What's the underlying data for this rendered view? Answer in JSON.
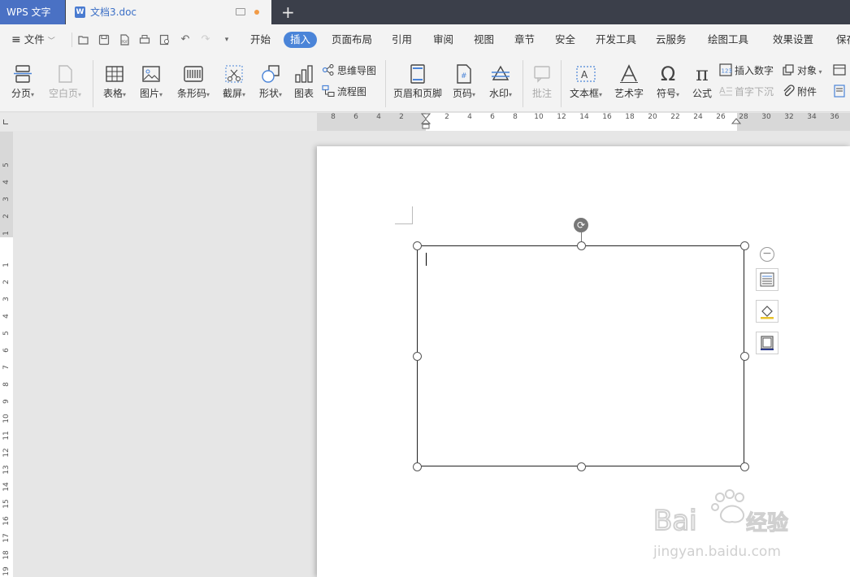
{
  "titlebar": {
    "app_name": "WPS 文字",
    "document_tab": "文档3.doc",
    "new_tab_symbol": "+"
  },
  "menubar": {
    "file_label": "文件",
    "items": [
      "开始",
      "插入",
      "页面布局",
      "引用",
      "审阅",
      "视图",
      "章节",
      "安全",
      "开发工具",
      "云服务",
      "绘图工具",
      "效果设置",
      "保存"
    ],
    "active_item": "插入"
  },
  "ribbon": {
    "page_break": "分页",
    "blank_page": "空白页",
    "table": "表格",
    "picture": "图片",
    "barcode": "条形码",
    "screenshot": "截屏",
    "shape": "形状",
    "chart": "图表",
    "mind_map": "思维导图",
    "flowchart": "流程图",
    "header_footer": "页眉和页脚",
    "page_number": "页码",
    "watermark": "水印",
    "comment": "批注",
    "text_box": "文本框",
    "word_art": "艺术字",
    "symbol": "符号",
    "formula": "公式",
    "insert_number": "插入数字",
    "drop_cap": "首字下沉",
    "object": "对象",
    "attachment": "附件"
  },
  "ruler": {
    "h_ticks": [
      "8",
      "6",
      "4",
      "2",
      "2",
      "4",
      "6",
      "8",
      "10",
      "12",
      "14",
      "16",
      "18",
      "20",
      "22",
      "24",
      "26",
      "28",
      "30",
      "32",
      "34",
      "36"
    ],
    "v_ticks_top": [
      "5",
      "4",
      "3",
      "2",
      "1"
    ],
    "v_ticks_main": [
      "1",
      "2",
      "3",
      "4",
      "5",
      "6",
      "7",
      "8",
      "9",
      "10",
      "11",
      "12",
      "13",
      "14",
      "15",
      "16",
      "17",
      "18",
      "19"
    ]
  },
  "colors": {
    "titlebar_bg": "#3b3f4a",
    "accent": "#4a84d8",
    "unsaved_dot": "#f19b47"
  }
}
